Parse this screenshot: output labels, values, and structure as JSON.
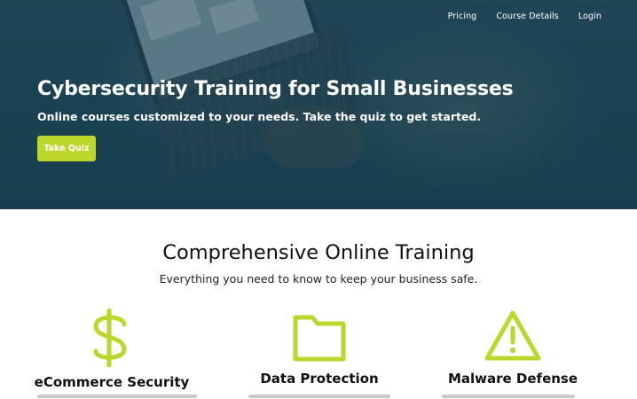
{
  "nav": {
    "items": [
      {
        "label": "Pricing"
      },
      {
        "label": "Course Details"
      },
      {
        "label": "Login"
      }
    ]
  },
  "hero": {
    "title": "Cybersecurity Training for Small Businesses",
    "subtitle": "Online courses customized to your needs. Take the quiz to get started.",
    "cta_label": "Take Quiz"
  },
  "section": {
    "title": "Comprehensive Online Training",
    "subtitle": "Everything you need to know to keep your business safe."
  },
  "features": [
    {
      "icon": "dollar-icon",
      "title": "eCommerce Security"
    },
    {
      "icon": "folder-icon",
      "title": "Data Protection"
    },
    {
      "icon": "warning-icon",
      "title": "Malware Defense"
    }
  ],
  "colors": {
    "accent": "#bcd62b",
    "hero_overlay": "#1f4656"
  }
}
